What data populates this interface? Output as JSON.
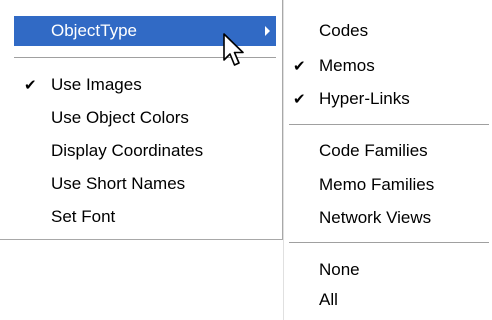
{
  "menu": {
    "items": [
      {
        "label": "ObjectType",
        "has_submenu": true,
        "highlighted": true,
        "checked": false
      },
      {
        "label": "Use Images",
        "checked": true
      },
      {
        "label": "Use Object Colors",
        "checked": false
      },
      {
        "label": "Display Coordinates",
        "checked": false
      },
      {
        "label": "Use Short Names",
        "checked": false
      },
      {
        "label": "Set Font",
        "checked": false
      }
    ],
    "check_glyph": "✔"
  },
  "submenu": {
    "items": [
      {
        "label": "Codes",
        "checked": false
      },
      {
        "label": "Memos",
        "checked": true
      },
      {
        "label": "Hyper-Links",
        "checked": true
      },
      {
        "label": "Code Families",
        "checked": false
      },
      {
        "label": "Memo Families",
        "checked": false
      },
      {
        "label": "Network Views",
        "checked": false
      },
      {
        "label": "None",
        "checked": false
      },
      {
        "label": "All",
        "checked": false
      }
    ]
  },
  "colors": {
    "highlight": "#316ac5",
    "highlight_text": "#ffffff",
    "separator": "#a0a0a0"
  },
  "icons": {
    "submenu_arrow": "triangle-right-icon",
    "check": "checkmark-icon",
    "cursor": "mouse-pointer-icon"
  }
}
